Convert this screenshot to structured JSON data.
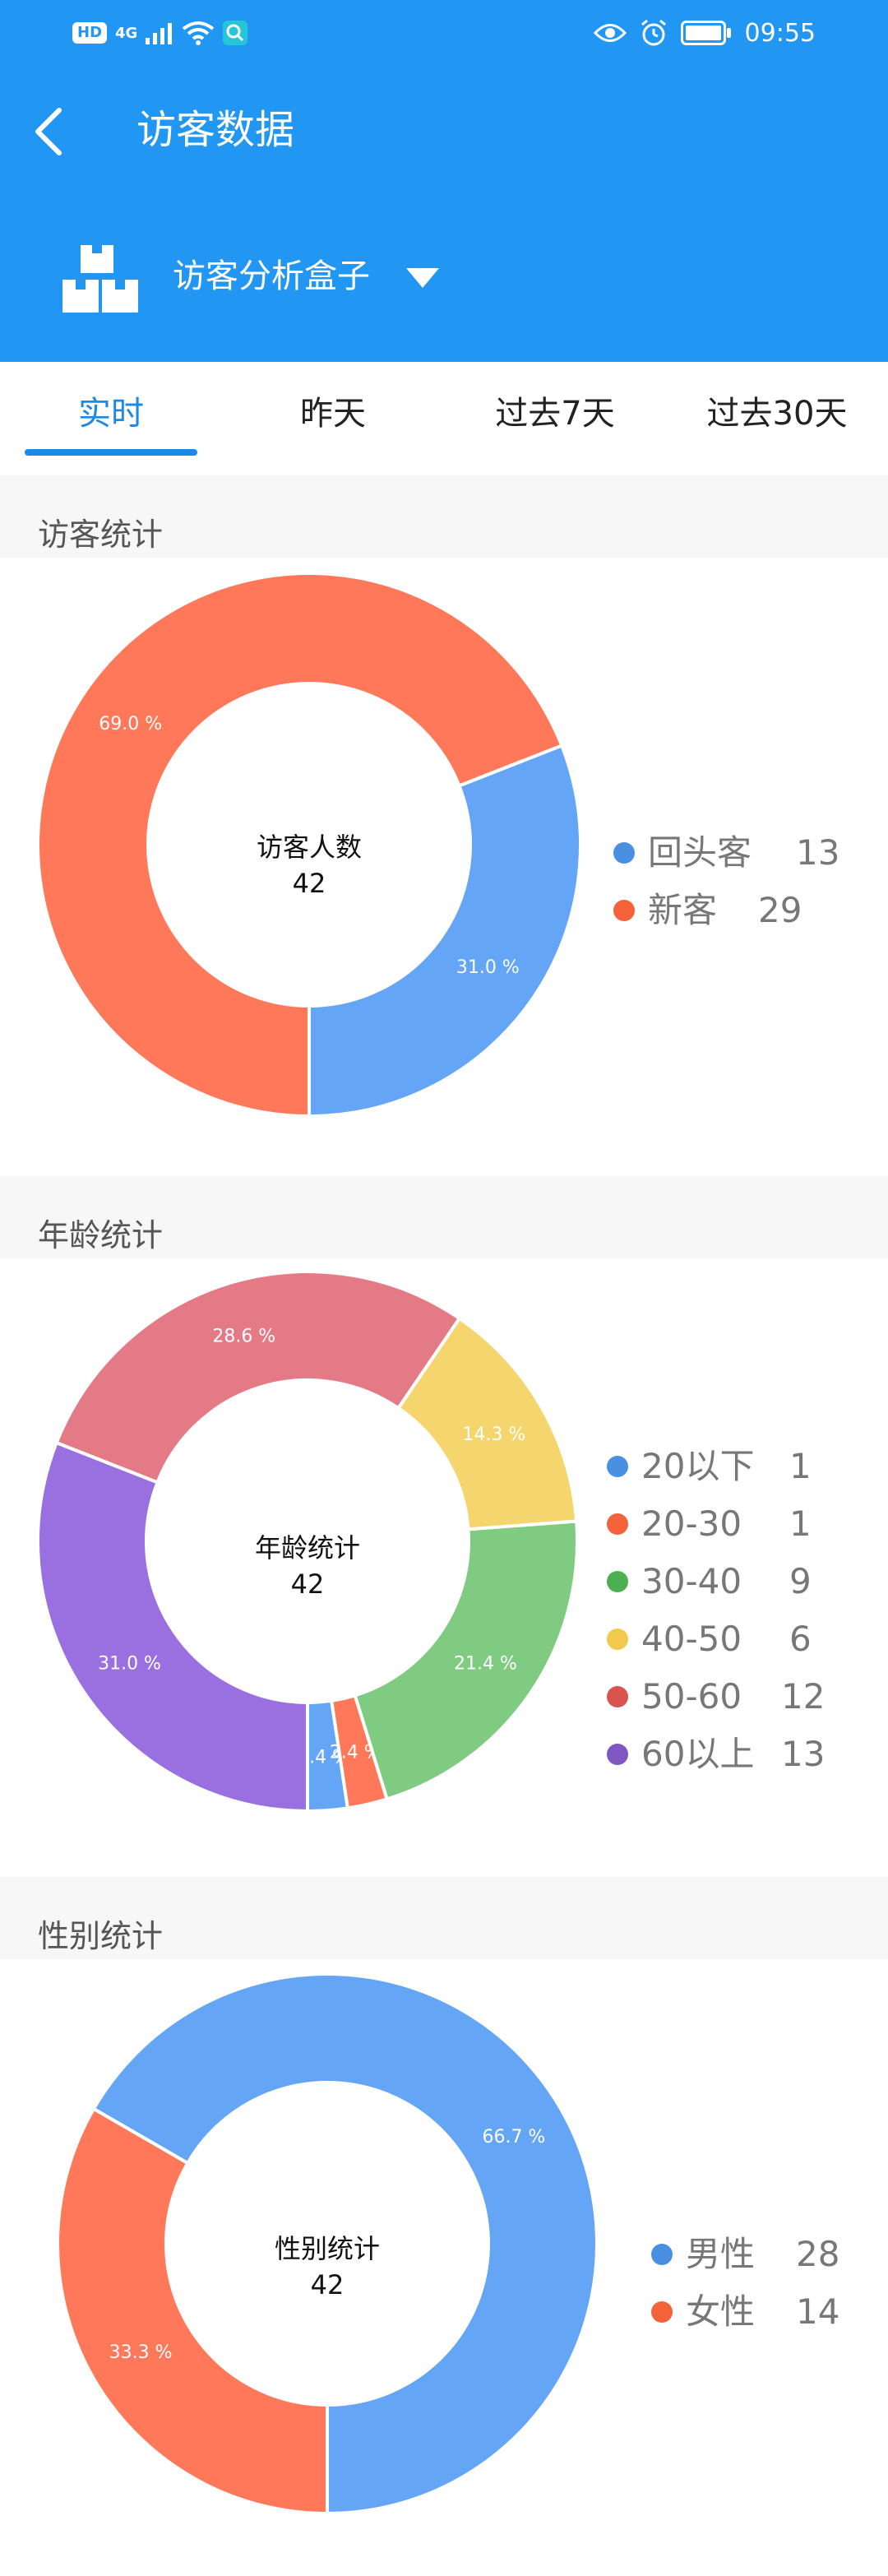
{
  "status_bar": {
    "left_badges": [
      "HD",
      "4G"
    ],
    "time": "09:55"
  },
  "header": {
    "title": "访客数据",
    "store_name": "访客分析盒子"
  },
  "tabs": [
    {
      "label": "实时",
      "active": true
    },
    {
      "label": "昨天",
      "active": false
    },
    {
      "label": "过去7天",
      "active": false
    },
    {
      "label": "过去30天",
      "active": false
    }
  ],
  "colors": {
    "primary": "#2196F3",
    "tab_active": "#1E88E5",
    "blue": "#64A5F5",
    "orange": "#FF7859",
    "green": "#7FCB82",
    "yellow": "#F5D66E",
    "pink": "#E37A86",
    "purple": "#9A70E0"
  },
  "sections": [
    {
      "title": "访客统计"
    },
    {
      "title": "年龄统计"
    },
    {
      "title": "性别统计"
    }
  ],
  "chart_data": [
    {
      "type": "pie",
      "center_title": "访客人数",
      "total": "42",
      "slices": [
        {
          "name": "回头客",
          "value": 13,
          "label": "31.0 %",
          "color": "#64A5F5"
        },
        {
          "name": "新客",
          "value": 29,
          "label": "69.0 %",
          "color": "#FF7859"
        }
      ]
    },
    {
      "type": "pie",
      "center_title": "年龄统计",
      "total": "42",
      "slices": [
        {
          "name": "20以下",
          "value": 1,
          "label": "2.4 %",
          "color": "#64A5F5"
        },
        {
          "name": "20-30",
          "value": 1,
          "label": "2.4 %",
          "color": "#FF7859"
        },
        {
          "name": "30-40",
          "value": 9,
          "label": "21.4 %",
          "color": "#7FCB82"
        },
        {
          "name": "40-50",
          "value": 6,
          "label": "14.3 %",
          "color": "#F5D66E"
        },
        {
          "name": "50-60",
          "value": 12,
          "label": "28.6 %",
          "color": "#E37A86"
        },
        {
          "name": "60以上",
          "value": 13,
          "label": "31.0 %",
          "color": "#9A70E0"
        }
      ]
    },
    {
      "type": "pie",
      "center_title": "性别统计",
      "total": "42",
      "slices": [
        {
          "name": "男性",
          "value": 28,
          "label": "66.7 %",
          "color": "#64A5F5"
        },
        {
          "name": "女性",
          "value": 14,
          "label": "33.3 %",
          "color": "#FF7859"
        }
      ]
    }
  ]
}
